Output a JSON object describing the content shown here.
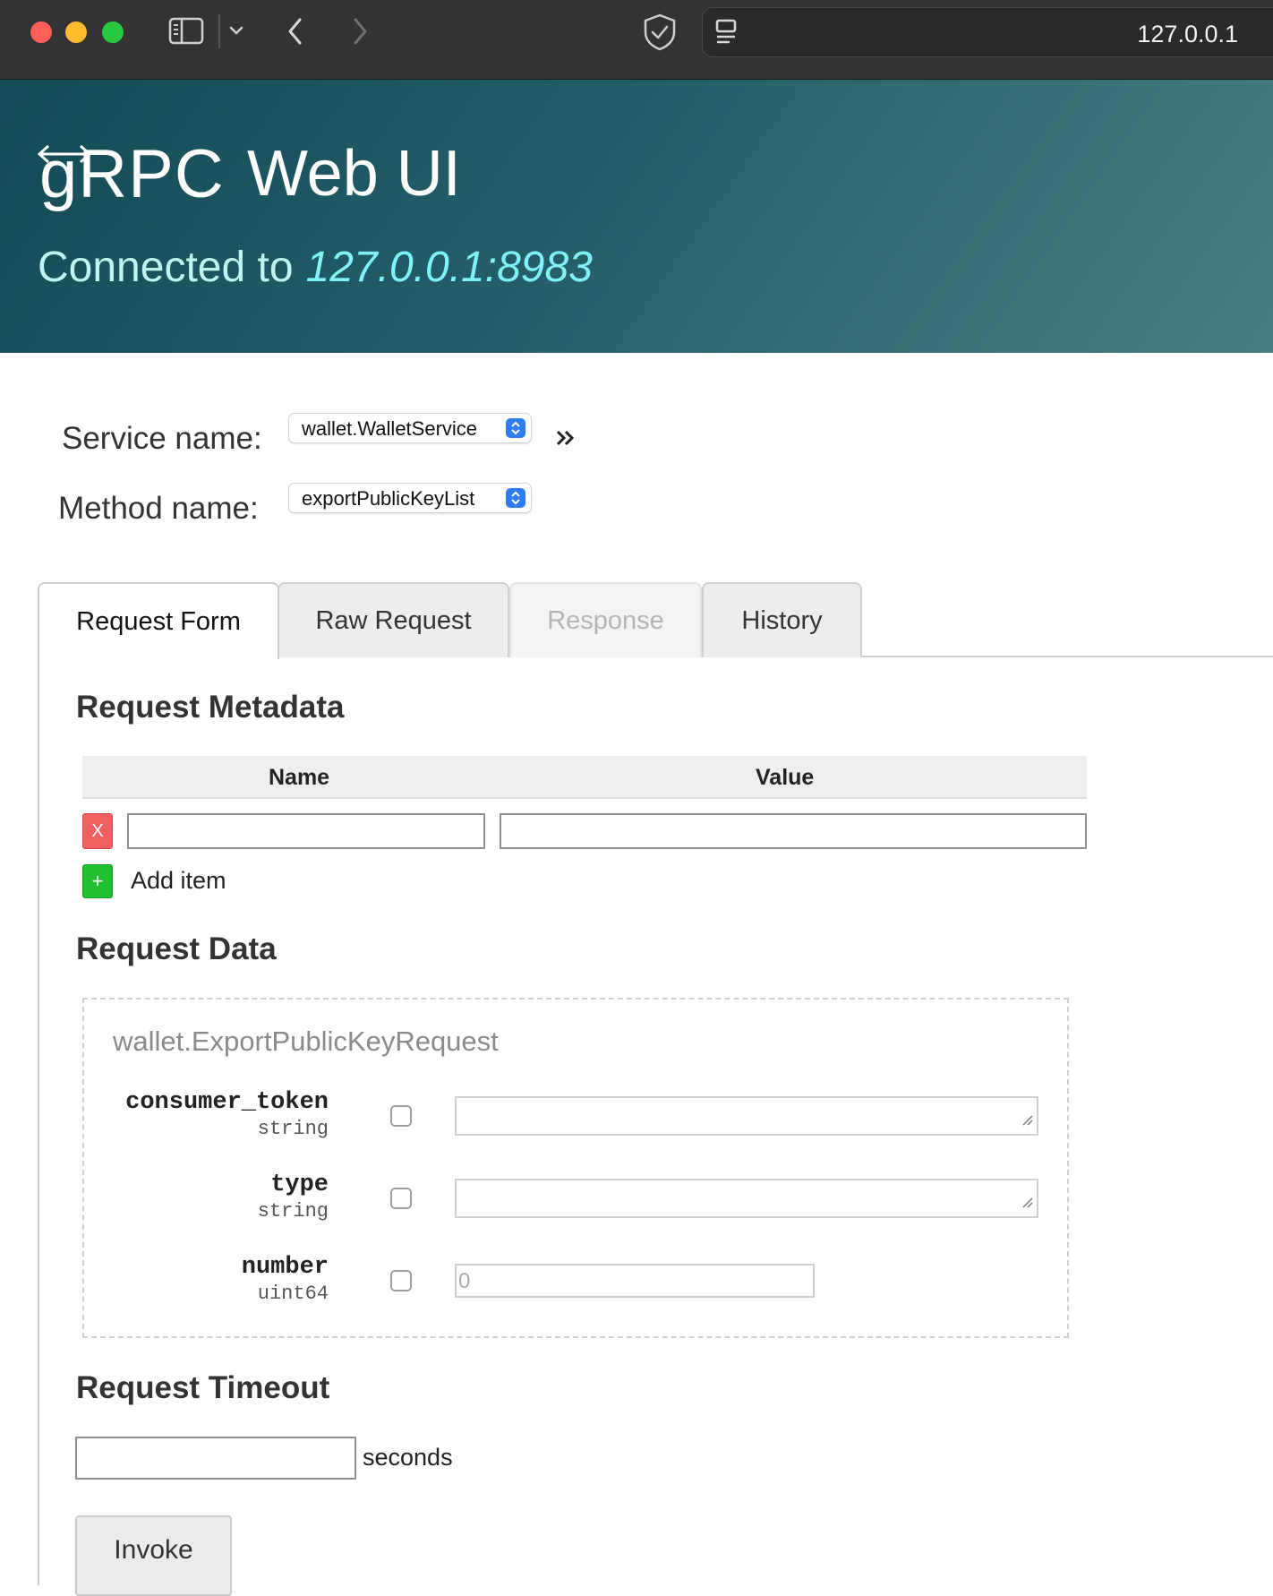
{
  "browser": {
    "address": "127.0.0.1",
    "icons": [
      "sidebar-icon",
      "chevron-down-icon",
      "back-icon",
      "forward-icon",
      "shield-icon",
      "page-icon"
    ]
  },
  "header": {
    "logo_text": "gRPC",
    "title": "Web UI",
    "connected_label": "Connected to",
    "host": "127.0.0.1:8983",
    "colors": {
      "hero_start": "#134a55",
      "hero_end": "#4b7e82",
      "host_text": "#7ff3f7"
    }
  },
  "selectors": {
    "service_label": "Service name:",
    "service_value": "wallet.WalletService",
    "method_label": "Method name:",
    "method_value": "exportPublicKeyList"
  },
  "tabs": [
    {
      "label": "Request Form",
      "state": "active"
    },
    {
      "label": "Raw Request",
      "state": "normal"
    },
    {
      "label": "Response",
      "state": "disabled"
    },
    {
      "label": "History",
      "state": "normal"
    }
  ],
  "metadata": {
    "title": "Request Metadata",
    "col_name": "Name",
    "col_value": "Value",
    "remove_label": "X",
    "add_icon": "+",
    "add_label": "Add item"
  },
  "request_data": {
    "title": "Request Data",
    "message_type": "wallet.ExportPublicKeyRequest",
    "fields": [
      {
        "name": "consumer_token",
        "type": "string"
      },
      {
        "name": "type",
        "type": "string"
      },
      {
        "name": "number",
        "type": "uint64",
        "placeholder": "0"
      }
    ]
  },
  "timeout": {
    "title": "Request Timeout",
    "unit": "seconds"
  },
  "invoke_label": "Invoke"
}
